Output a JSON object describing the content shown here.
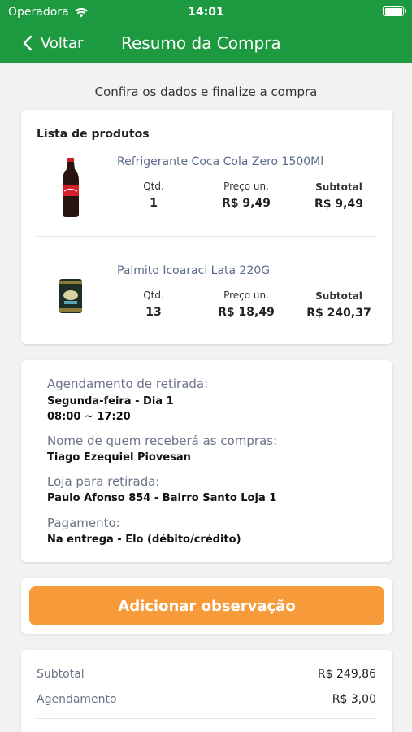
{
  "status_bar": {
    "carrier": "Operadora",
    "time": "14:01"
  },
  "nav": {
    "back_label": "Voltar",
    "title": "Resumo da Compra"
  },
  "subtitle": "Confira os dados e finalize a compra",
  "products_section": {
    "title": "Lista de produtos",
    "qty_header": "Qtd.",
    "unit_price_header": "Preço un.",
    "subtotal_header": "Subtotal",
    "items": [
      {
        "name": "Refrigerante Coca Cola Zero 1500Ml",
        "qty": "1",
        "unit_price": "R$ 9,49",
        "subtotal": "R$ 9,49"
      },
      {
        "name": "Palmito Icoaraci Lata 220G",
        "qty": "13",
        "unit_price": "R$ 18,49",
        "subtotal": "R$ 240,37"
      }
    ]
  },
  "details": {
    "schedule_label": "Agendamento de retirada:",
    "schedule_day": "Segunda-feira - Dia 1",
    "schedule_time": "08:00 ~ 17:20",
    "receiver_label": "Nome de quem receberá as compras:",
    "receiver_value": "Tiago Ezequiel Piovesan",
    "store_label": "Loja para retirada:",
    "store_value": "Paulo Afonso 854 - Bairro Santo Loja 1",
    "payment_label": "Pagamento:",
    "payment_value": "Na entrega - Elo (débito/crédito)"
  },
  "observation_button": "Adicionar observação",
  "totals": {
    "subtotal_label": "Subtotal",
    "subtotal_value": "R$ 249,86",
    "scheduling_label": "Agendamento",
    "scheduling_value": "R$ 3,00"
  },
  "colors": {
    "header": "#1d9a3f",
    "accent_button": "#f79b3a"
  }
}
